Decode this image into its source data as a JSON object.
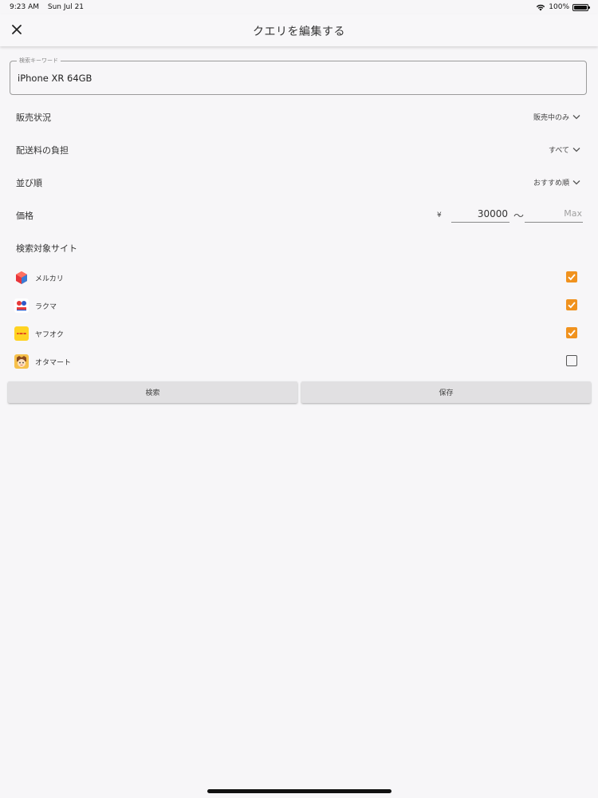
{
  "status_bar": {
    "time": "9:23 AM",
    "date": "Sun Jul 21",
    "battery": "100%"
  },
  "header": {
    "title": "クエリを編集する",
    "close_icon": "close-icon"
  },
  "keyword": {
    "label": "検索キーワード",
    "value": "iPhone XR 64GB"
  },
  "filters": {
    "sale_status": {
      "label": "販売状況",
      "value": "販売中のみ"
    },
    "shipping": {
      "label": "配送料の負担",
      "value": "すべて"
    },
    "sort": {
      "label": "並び順",
      "value": "おすすめ順"
    }
  },
  "price": {
    "label": "価格",
    "currency": "¥",
    "min": "30000",
    "separator": "～",
    "max_placeholder": "Max"
  },
  "sites": {
    "label": "検索対象サイト",
    "items": [
      {
        "name": "メルカリ",
        "checked": true
      },
      {
        "name": "ラクマ",
        "checked": true
      },
      {
        "name": "ヤフオク",
        "checked": true
      },
      {
        "name": "オタマート",
        "checked": false
      }
    ]
  },
  "actions": {
    "search_label": "検索",
    "save_label": "保存"
  },
  "colors": {
    "accent": "#f0921e",
    "background": "#f7f6f8",
    "button": "#e1e0e2"
  }
}
